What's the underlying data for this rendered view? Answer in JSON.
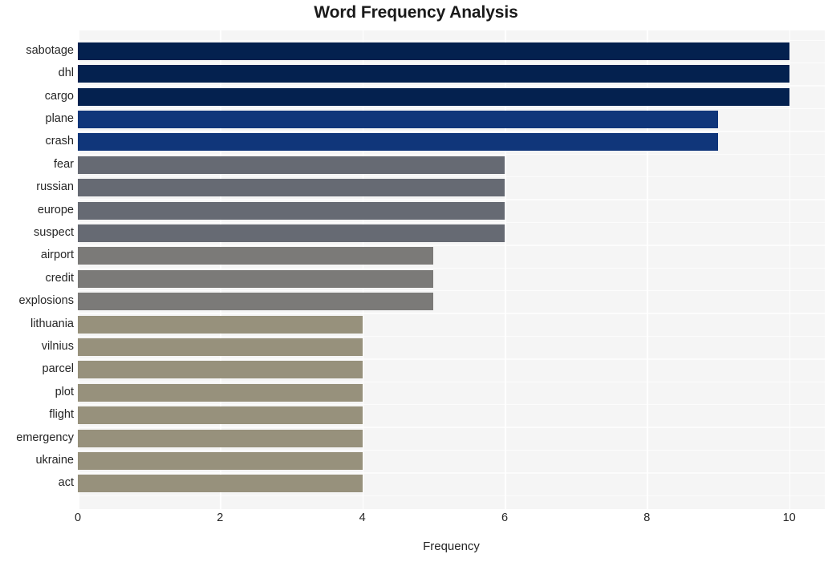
{
  "chart_data": {
    "type": "bar",
    "orientation": "horizontal",
    "title": "Word Frequency Analysis",
    "xlabel": "Frequency",
    "ylabel": "",
    "xlim": [
      0,
      10.5
    ],
    "xticks": [
      0,
      2,
      4,
      6,
      8,
      10
    ],
    "xtick_labels": [
      "0",
      "2",
      "4",
      "6",
      "8",
      "10"
    ],
    "grid": true,
    "grid_color": "#ffffff",
    "plot_background": "#f5f5f5",
    "figure_background": "#ffffff",
    "legend": null,
    "categories": [
      "sabotage",
      "dhl",
      "cargo",
      "plane",
      "crash",
      "fear",
      "russian",
      "europe",
      "suspect",
      "airport",
      "credit",
      "explosions",
      "lithuania",
      "vilnius",
      "parcel",
      "plot",
      "flight",
      "emergency",
      "ukraine",
      "act"
    ],
    "values": [
      10,
      10,
      10,
      9,
      9,
      6,
      6,
      6,
      6,
      5,
      5,
      5,
      4,
      4,
      4,
      4,
      4,
      4,
      4,
      4
    ],
    "bar_colors": [
      "#04214f",
      "#04214f",
      "#04214f",
      "#10367a",
      "#10367a",
      "#666a73",
      "#666a73",
      "#666a73",
      "#666a73",
      "#7b7a78",
      "#7b7a78",
      "#7b7a78",
      "#97917c",
      "#97917c",
      "#97917c",
      "#97917c",
      "#97917c",
      "#97917c",
      "#97917c",
      "#97917c"
    ]
  }
}
